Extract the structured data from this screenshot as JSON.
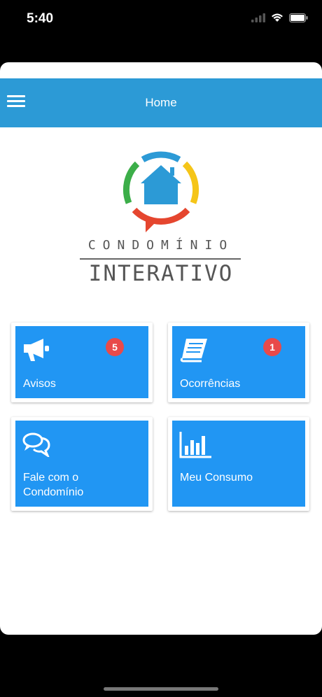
{
  "status": {
    "time": "5:40"
  },
  "appbar": {
    "title": "Home"
  },
  "logo": {
    "line1": "CONDOMÍNIO",
    "line2": "INTERATIVO"
  },
  "cards": [
    {
      "label": "Avisos",
      "badge": "5",
      "icon": "megaphone-icon"
    },
    {
      "label": "Ocorrências",
      "badge": "1",
      "icon": "book-icon"
    },
    {
      "label": "Fale com o Condomínio",
      "icon": "chat-icon"
    },
    {
      "label": "Meu Consumo",
      "icon": "bar-chart-icon"
    }
  ],
  "colors": {
    "appbar": "#2c9ad6",
    "card": "#2196f3",
    "badge": "#e84a4a"
  }
}
